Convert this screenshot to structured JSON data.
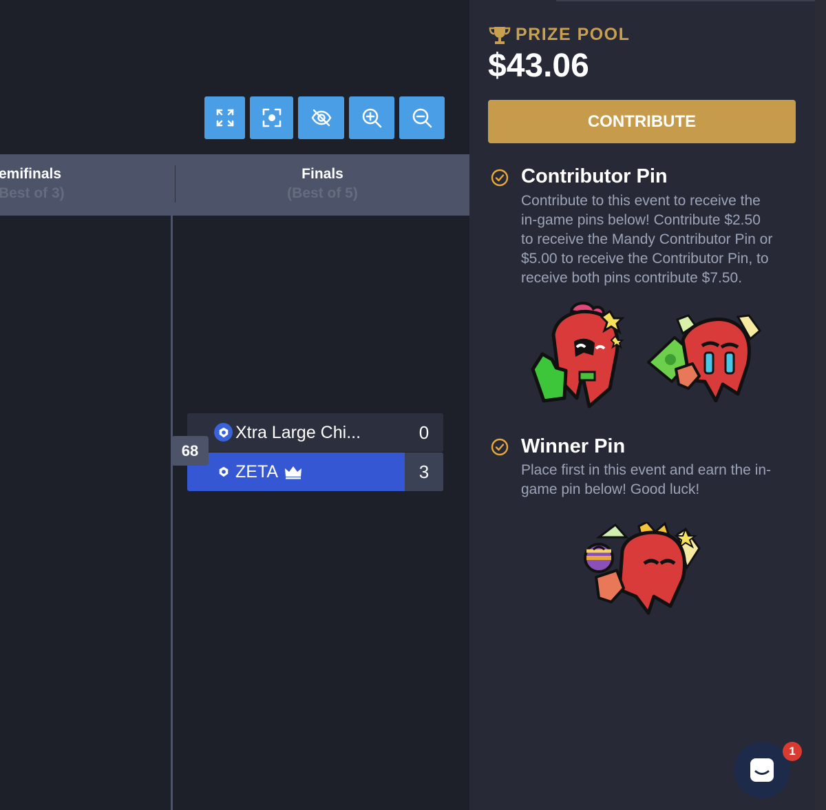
{
  "toolbar": {
    "buttons": [
      {
        "name": "fullscreen",
        "icon": "expand-icon"
      },
      {
        "name": "focus",
        "icon": "focus-target-icon"
      },
      {
        "name": "hide",
        "icon": "eye-off-icon"
      },
      {
        "name": "zoom-in",
        "icon": "zoom-in-icon"
      },
      {
        "name": "zoom-out",
        "icon": "zoom-out-icon"
      }
    ]
  },
  "rounds": [
    {
      "name": "emifinals",
      "format": "Best of 3)"
    },
    {
      "name": "Finals",
      "format": "(Best of 5)"
    }
  ],
  "match": {
    "number": "68",
    "teams": [
      {
        "name": "Xtra Large Chi...",
        "score": "0",
        "winner": false
      },
      {
        "name": "ZETA",
        "score": "3",
        "winner": true
      }
    ]
  },
  "panel": {
    "prize_label": "PRIZE POOL",
    "prize_value": "$43.06",
    "contribute_label": "CONTRIBUTE",
    "contributor": {
      "title": "Contributor Pin",
      "lines": [
        "Contribute to this event to receive the",
        "in-game pins below! Contribute $2.50",
        "to receive the Mandy Contributor Pin or",
        "$5.00 to receive the Contributor Pin, to",
        "receive both pins contribute $7.50."
      ]
    },
    "winner": {
      "title": "Winner Pin",
      "lines": [
        "Place first in this event and earn the in-",
        "game pin below! Good luck!"
      ]
    }
  },
  "chat": {
    "badge": "1"
  },
  "colors": {
    "accent_gold": "#c69c4c",
    "toolbar_blue": "#4a9ee6",
    "winner_blue": "#3657d4",
    "background": "#1e2029",
    "panel": "#272a36"
  }
}
